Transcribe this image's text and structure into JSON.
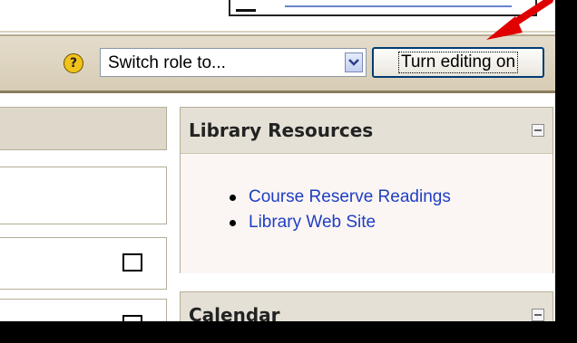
{
  "navbar": {
    "role_select_value": "Switch role to...",
    "edit_button_label": "Turn editing on"
  },
  "library_block": {
    "title": "Library Resources",
    "links": [
      "Course Reserve Readings",
      "Library Web Site"
    ]
  },
  "calendar_block": {
    "title": "Calendar"
  },
  "colors": {
    "link": "#1f3ec2",
    "navbar": "#d7cdb6",
    "annotation_arrow": "#e00000",
    "block_body": "#fbf6f4"
  },
  "icons": [
    "help-icon",
    "dropdown-arrow-icon",
    "collapse-icon",
    "red-arrow-annotation"
  ]
}
